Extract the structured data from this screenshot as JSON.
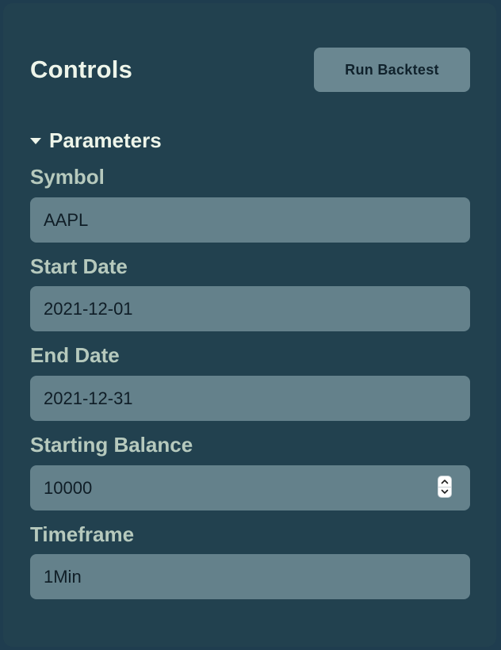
{
  "header": {
    "title": "Controls",
    "run_button_label": "Run Backtest"
  },
  "parameters": {
    "section_label": "Parameters",
    "expanded": true,
    "fields": {
      "symbol": {
        "label": "Symbol",
        "value": "AAPL"
      },
      "start_date": {
        "label": "Start Date",
        "value": "2021-12-01"
      },
      "end_date": {
        "label": "End Date",
        "value": "2021-12-31"
      },
      "starting_balance": {
        "label": "Starting Balance",
        "value": "10000"
      },
      "timeframe": {
        "label": "Timeframe",
        "value": "1Min"
      }
    }
  },
  "icons": {
    "section_toggle": "caret-down-icon",
    "stepper_up": "chevron-up-icon",
    "stepper_down": "chevron-down-icon"
  },
  "colors": {
    "panel_background": "#22414f",
    "input_background": "#64818b",
    "button_background": "#6a8791",
    "title_text": "#eef5ea",
    "label_text": "#b6c9bd"
  }
}
